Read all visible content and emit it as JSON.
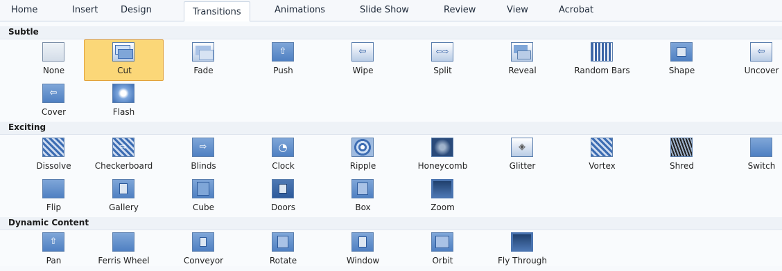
{
  "tabs": [
    {
      "label": "Home",
      "active": false
    },
    {
      "label": "Insert",
      "active": false
    },
    {
      "label": "Design",
      "active": false
    },
    {
      "label": "Transitions",
      "active": true
    },
    {
      "label": "Animations",
      "active": false
    },
    {
      "label": "Slide Show",
      "active": false
    },
    {
      "label": "Review",
      "active": false
    },
    {
      "label": "View",
      "active": false
    },
    {
      "label": "Acrobat",
      "active": false
    }
  ],
  "sections": {
    "subtle": {
      "title": "Subtle",
      "items": [
        {
          "label": "None",
          "icon": "none-icon"
        },
        {
          "label": "Cut",
          "icon": "cut-icon",
          "selected": true
        },
        {
          "label": "Fade",
          "icon": "fade-icon"
        },
        {
          "label": "Push",
          "icon": "push-icon"
        },
        {
          "label": "Wipe",
          "icon": "wipe-icon"
        },
        {
          "label": "Split",
          "icon": "split-icon"
        },
        {
          "label": "Reveal",
          "icon": "reveal-icon"
        },
        {
          "label": "Random Bars",
          "icon": "random-bars-icon"
        },
        {
          "label": "Shape",
          "icon": "shape-icon"
        },
        {
          "label": "Uncover",
          "icon": "uncover-icon"
        },
        {
          "label": "Cover",
          "icon": "cover-icon"
        },
        {
          "label": "Flash",
          "icon": "flash-icon"
        }
      ]
    },
    "exciting": {
      "title": "Exciting",
      "items": [
        {
          "label": "Dissolve",
          "icon": "dissolve-icon"
        },
        {
          "label": "Checkerboard",
          "icon": "checkerboard-icon"
        },
        {
          "label": "Blinds",
          "icon": "blinds-icon"
        },
        {
          "label": "Clock",
          "icon": "clock-icon"
        },
        {
          "label": "Ripple",
          "icon": "ripple-icon"
        },
        {
          "label": "Honeycomb",
          "icon": "honeycomb-icon"
        },
        {
          "label": "Glitter",
          "icon": "glitter-icon"
        },
        {
          "label": "Vortex",
          "icon": "vortex-icon"
        },
        {
          "label": "Shred",
          "icon": "shred-icon"
        },
        {
          "label": "Switch",
          "icon": "switch-icon"
        },
        {
          "label": "Flip",
          "icon": "flip-icon"
        },
        {
          "label": "Gallery",
          "icon": "gallery-icon"
        },
        {
          "label": "Cube",
          "icon": "cube-icon"
        },
        {
          "label": "Doors",
          "icon": "doors-icon"
        },
        {
          "label": "Box",
          "icon": "box-icon"
        },
        {
          "label": "Zoom",
          "icon": "zoom-icon"
        }
      ]
    },
    "dynamic": {
      "title": "Dynamic Content",
      "items": [
        {
          "label": "Pan",
          "icon": "pan-icon"
        },
        {
          "label": "Ferris Wheel",
          "icon": "ferris-wheel-icon"
        },
        {
          "label": "Conveyor",
          "icon": "conveyor-icon"
        },
        {
          "label": "Rotate",
          "icon": "rotate-icon"
        },
        {
          "label": "Window",
          "icon": "window-icon"
        },
        {
          "label": "Orbit",
          "icon": "orbit-icon"
        },
        {
          "label": "Fly Through",
          "icon": "fly-through-icon"
        }
      ]
    }
  },
  "colors": {
    "selected_fill": "#fbd778",
    "selected_border": "#e2a13b",
    "icon_blue": "#3d6db3"
  }
}
